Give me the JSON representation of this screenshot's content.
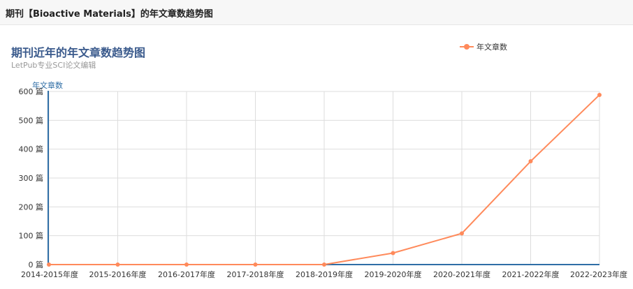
{
  "header": {
    "title": "期刊【Bioactive Materials】的年文章数趋势图"
  },
  "chart_data": {
    "type": "line",
    "title": "期刊近年的年文章数趋势图",
    "subtitle": "LetPub专业SCI论文编辑",
    "ylabel": "年文章数",
    "xlabel": "",
    "y_unit": "篇",
    "ylim": [
      0,
      600
    ],
    "yticks": [
      0,
      100,
      200,
      300,
      400,
      500,
      600
    ],
    "categories": [
      "2014-2015年度",
      "2015-2016年度",
      "2016-2017年度",
      "2017-2018年度",
      "2018-2019年度",
      "2019-2020年度",
      "2020-2021年度",
      "2021-2022年度",
      "2022-2023年度"
    ],
    "series": [
      {
        "name": "年文章数",
        "color": "#ff8a5b",
        "values": [
          0,
          0,
          0,
          0,
          0,
          40,
          108,
          358,
          588
        ]
      }
    ],
    "legend_position": "top-right",
    "grid": true
  }
}
